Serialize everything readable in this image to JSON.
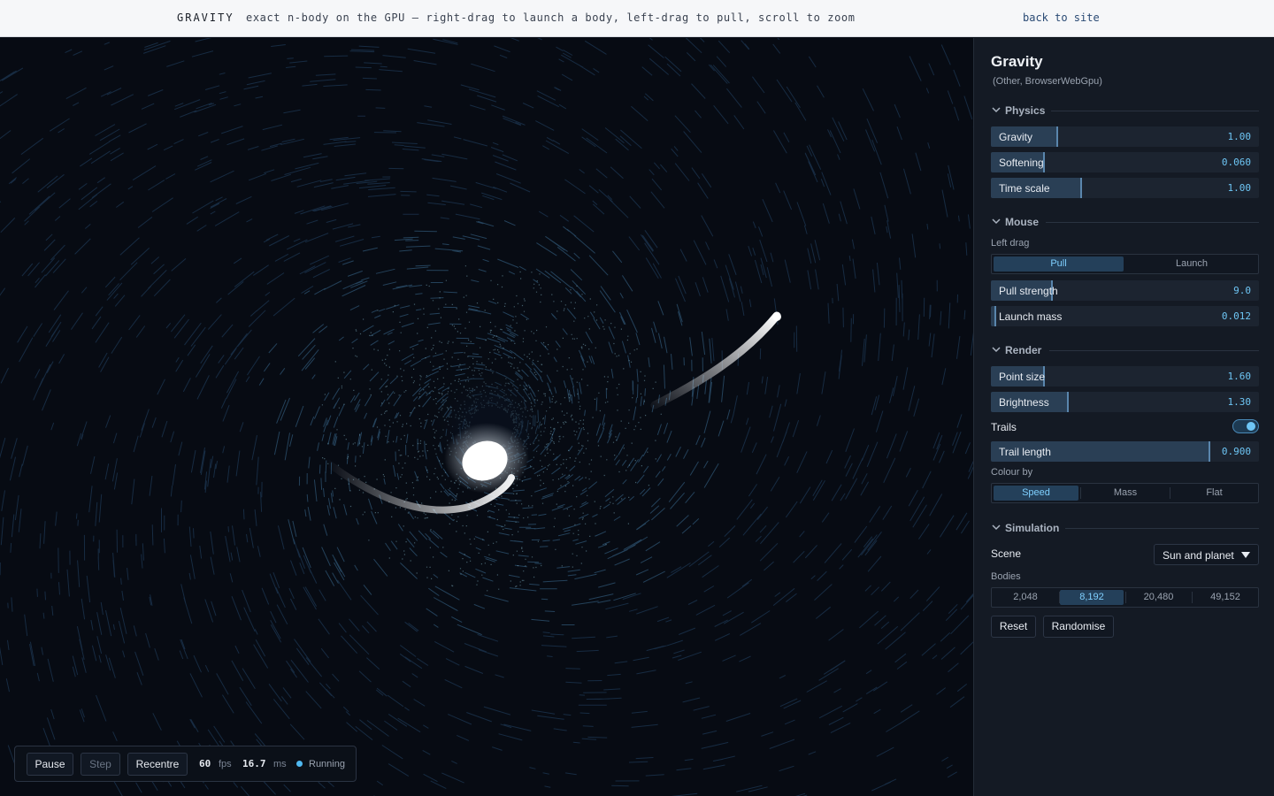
{
  "topbar": {
    "brand": "GRAVITY",
    "description": "exact n-body on the GPU — right-drag to launch a body, left-drag to pull, scroll to zoom",
    "back_link": "back to site"
  },
  "controls": {
    "pause_label": "Pause",
    "step_label": "Step",
    "recentre_label": "Recentre",
    "fps_value": "60",
    "fps_unit": "fps",
    "ms_value": "16.7",
    "ms_unit": "ms",
    "status": "Running",
    "status_color": "#4fb8f0"
  },
  "panel": {
    "title": "Gravity",
    "subtitle": "(Other, BrowserWebGpu)",
    "physics": {
      "heading": "Physics",
      "sliders": [
        {
          "name": "Gravity",
          "value": "1.00",
          "level": 0.25
        },
        {
          "name": "Softening",
          "value": "0.060",
          "level": 0.2
        },
        {
          "name": "Time scale",
          "value": "1.00",
          "level": 0.34
        }
      ]
    },
    "mouse": {
      "heading": "Mouse",
      "left_drag_label": "Left drag",
      "left_drag_options": [
        "Pull",
        "Launch"
      ],
      "left_drag_selected": "Pull",
      "sliders": [
        {
          "name": "Pull strength",
          "value": "9.0",
          "level": 0.23
        },
        {
          "name": "Launch mass",
          "value": "0.012",
          "level": 0.02
        }
      ]
    },
    "render": {
      "heading": "Render",
      "sliders": [
        {
          "name": "Point size",
          "value": "1.60",
          "level": 0.2
        },
        {
          "name": "Brightness",
          "value": "1.30",
          "level": 0.29
        }
      ],
      "trails_label": "Trails",
      "trails_on": true,
      "trail_length": {
        "name": "Trail length",
        "value": "0.900",
        "level": 0.82
      },
      "colour_by_label": "Colour by",
      "colour_by_options": [
        "Speed",
        "Mass",
        "Flat"
      ],
      "colour_by_selected": "Speed"
    },
    "simulation": {
      "heading": "Simulation",
      "scene_label": "Scene",
      "scene_value": "Sun and planet",
      "bodies_label": "Bodies",
      "bodies_options": [
        "2,048",
        "8,192",
        "20,480",
        "49,152"
      ],
      "bodies_selected": "8,192",
      "reset_label": "Reset",
      "randomise_label": "Randomise"
    }
  },
  "colors": {
    "accent": "#6ec6f5",
    "panel_bg": "#141a24",
    "canvas_bg": "#070b13"
  }
}
